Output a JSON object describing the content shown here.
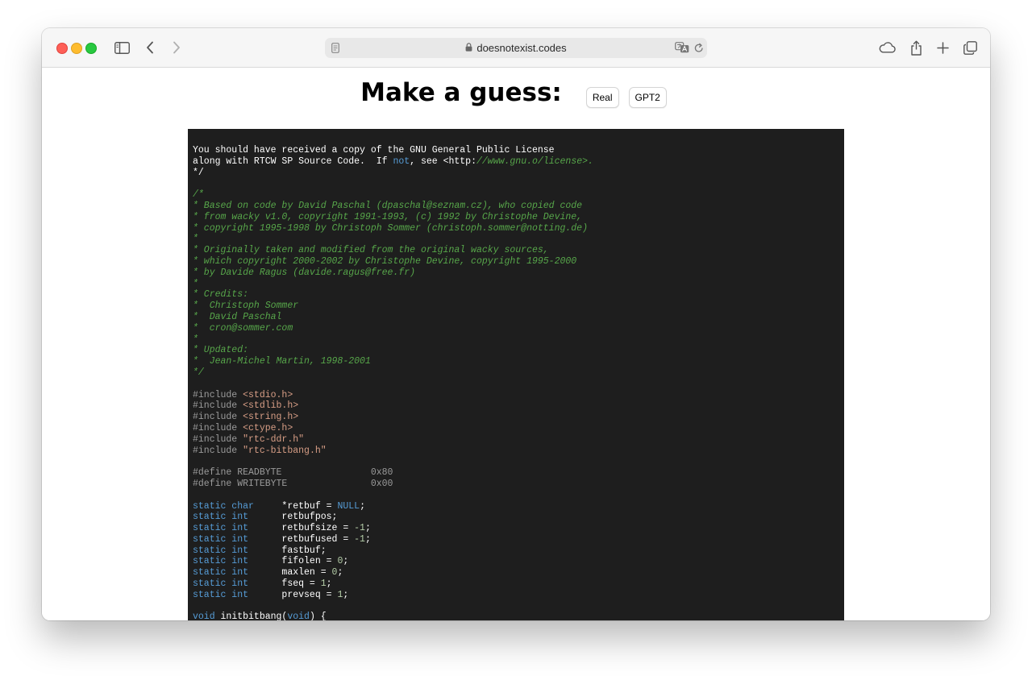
{
  "browser": {
    "url": "doesnotexist.codes",
    "icons": {
      "sidebar": "sidebar-icon",
      "back": "chevron-left-icon",
      "forward": "chevron-right-icon",
      "page": "page-icon",
      "lock": "lock-icon",
      "translate": "translate-icon",
      "reload": "reload-icon",
      "icloud": "cloud-icon",
      "share": "share-icon",
      "new_tab": "plus-icon",
      "tabs": "tab-overview-icon"
    }
  },
  "page": {
    "heading": "Make a guess:",
    "buttons": {
      "real": "Real",
      "gpt2": "GPT2"
    }
  },
  "theme": {
    "plain": "#ffffff",
    "comment": "#57a64a",
    "keyword": "#569cd6",
    "preprocessor": "#9b9b9b",
    "string": "#d69d85",
    "number": "#b5cea8",
    "background": "#1e1e1e"
  },
  "code": [
    [
      [
        "plain",
        "You should have received a copy of the GNU General Public License"
      ]
    ],
    [
      [
        "plain",
        "along with RTCW SP Source Code.  If "
      ],
      [
        "keyword",
        "not"
      ],
      [
        "plain",
        ", see <http:"
      ],
      [
        "comment",
        "//www.gnu.o/license>."
      ]
    ],
    [
      [
        "plain",
        "*/"
      ]
    ],
    [],
    [
      [
        "comment",
        "/*"
      ]
    ],
    [
      [
        "comment",
        "* Based on code by David Paschal (dpaschal@seznam.cz), who copied code"
      ]
    ],
    [
      [
        "comment",
        "* from wacky v1.0, copyright 1991-1993, (c) 1992 by Christophe Devine,"
      ]
    ],
    [
      [
        "comment",
        "* copyright 1995-1998 by Christoph Sommer (christoph.sommer@notting.de)"
      ]
    ],
    [
      [
        "comment",
        "*"
      ]
    ],
    [
      [
        "comment",
        "* Originally taken and modified from the original wacky sources,"
      ]
    ],
    [
      [
        "comment",
        "* which copyright 2000-2002 by Christophe Devine, copyright 1995-2000"
      ]
    ],
    [
      [
        "comment",
        "* by Davide Ragus (davide.ragus@free.fr)"
      ]
    ],
    [
      [
        "comment",
        "*"
      ]
    ],
    [
      [
        "comment",
        "* Credits:"
      ]
    ],
    [
      [
        "comment",
        "*  Christoph Sommer"
      ]
    ],
    [
      [
        "comment",
        "*  David Paschal"
      ]
    ],
    [
      [
        "comment",
        "*  cron@sommer.com"
      ]
    ],
    [
      [
        "comment",
        "*"
      ]
    ],
    [
      [
        "comment",
        "* Updated:"
      ]
    ],
    [
      [
        "comment",
        "*  Jean-Michel Martin, 1998-2001"
      ]
    ],
    [
      [
        "comment",
        "*/"
      ]
    ],
    [],
    [
      [
        "preprocessor",
        "#include "
      ],
      [
        "string",
        "<stdio.h>"
      ]
    ],
    [
      [
        "preprocessor",
        "#include "
      ],
      [
        "string",
        "<stdlib.h>"
      ]
    ],
    [
      [
        "preprocessor",
        "#include "
      ],
      [
        "string",
        "<string.h>"
      ]
    ],
    [
      [
        "preprocessor",
        "#include "
      ],
      [
        "string",
        "<ctype.h>"
      ]
    ],
    [
      [
        "preprocessor",
        "#include "
      ],
      [
        "string",
        "\"rtc-ddr.h\""
      ]
    ],
    [
      [
        "preprocessor",
        "#include "
      ],
      [
        "string",
        "\"rtc-bitbang.h\""
      ]
    ],
    [],
    [
      [
        "preprocessor",
        "#define READBYTE                0x80"
      ]
    ],
    [
      [
        "preprocessor",
        "#define WRITEBYTE               0x00"
      ]
    ],
    [],
    [
      [
        "keyword",
        "static char"
      ],
      [
        "plain",
        "     *retbuf = "
      ],
      [
        "keyword",
        "NULL"
      ],
      [
        "plain",
        ";"
      ]
    ],
    [
      [
        "keyword",
        "static int"
      ],
      [
        "plain",
        "      retbufpos;"
      ]
    ],
    [
      [
        "keyword",
        "static int"
      ],
      [
        "plain",
        "      retbufsize = "
      ],
      [
        "number",
        "-1"
      ],
      [
        "plain",
        ";"
      ]
    ],
    [
      [
        "keyword",
        "static int"
      ],
      [
        "plain",
        "      retbufused = "
      ],
      [
        "number",
        "-1"
      ],
      [
        "plain",
        ";"
      ]
    ],
    [
      [
        "keyword",
        "static int"
      ],
      [
        "plain",
        "      fastbuf;"
      ]
    ],
    [
      [
        "keyword",
        "static int"
      ],
      [
        "plain",
        "      fifolen = "
      ],
      [
        "number",
        "0"
      ],
      [
        "plain",
        ";"
      ]
    ],
    [
      [
        "keyword",
        "static int"
      ],
      [
        "plain",
        "      maxlen = "
      ],
      [
        "number",
        "0"
      ],
      [
        "plain",
        ";"
      ]
    ],
    [
      [
        "keyword",
        "static int"
      ],
      [
        "plain",
        "      fseq = "
      ],
      [
        "number",
        "1"
      ],
      [
        "plain",
        ";"
      ]
    ],
    [
      [
        "keyword",
        "static int"
      ],
      [
        "plain",
        "      prevseq = "
      ],
      [
        "number",
        "1"
      ],
      [
        "plain",
        ";"
      ]
    ],
    [],
    [
      [
        "keyword",
        "void"
      ],
      [
        "plain",
        " initbitbang("
      ],
      [
        "keyword",
        "void"
      ],
      [
        "plain",
        ") {"
      ]
    ]
  ]
}
